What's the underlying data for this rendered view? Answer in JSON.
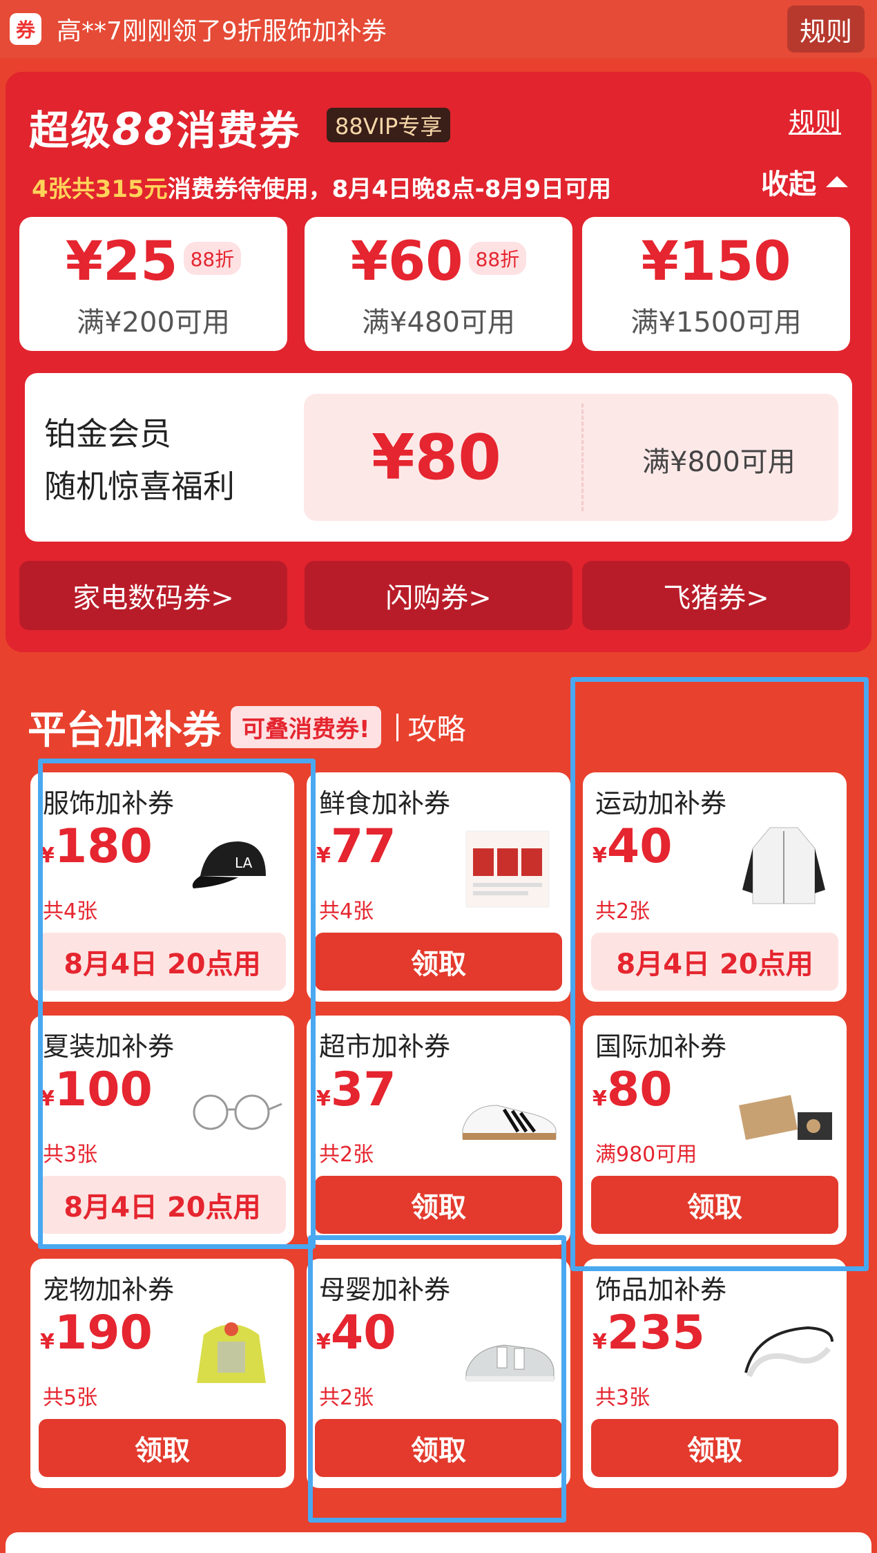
{
  "notice": {
    "icon": "ticket-icon",
    "icon_glyph": "券",
    "text": "高**7刚刚领了9折服饰加补券",
    "rule": "规则"
  },
  "super88": {
    "title_pre": "超级",
    "title_num": "88",
    "title_post": "消费券",
    "vip_badge": "88VIP专享",
    "rule": "规则",
    "sub_hl": "4张共315元",
    "sub_rest": "消费券待使用，8月4日晚8点-8月9日可用",
    "collapse": "收起",
    "coupons": [
      {
        "amount": "¥25",
        "badge": "88折",
        "cond": "满¥200可用"
      },
      {
        "amount": "¥60",
        "badge": "88折",
        "cond": "满¥480可用"
      },
      {
        "amount": "¥150",
        "badge": "",
        "cond": "满¥1500可用"
      }
    ],
    "platinum": {
      "line1": "铂金会员",
      "line2": "随机惊喜福利",
      "amount": "¥80",
      "cond": "满¥800可用"
    },
    "categories": [
      "家电数码券>",
      "闪购券>",
      "飞猪券>"
    ]
  },
  "platform": {
    "title": "平台加补券",
    "badge": "可叠消费券!",
    "guide": "攻略",
    "cards": [
      {
        "name": "服饰加补券",
        "yen": "¥",
        "amount": "180",
        "count": "共4张",
        "button": "8月4日 20点用",
        "pending": true,
        "icon": "cap-icon"
      },
      {
        "name": "鲜食加补券",
        "yen": "¥",
        "amount": "77",
        "count": "共4张",
        "button": "领取",
        "pending": false,
        "icon": "recipe-card-icon"
      },
      {
        "name": "运动加补券",
        "yen": "¥",
        "amount": "40",
        "count": "共2张",
        "button": "8月4日 20点用",
        "pending": true,
        "icon": "jacket-icon"
      },
      {
        "name": "夏装加补券",
        "yen": "¥",
        "amount": "100",
        "count": "共3张",
        "button": "8月4日 20点用",
        "pending": true,
        "icon": "glasses-icon"
      },
      {
        "name": "超市加补券",
        "yen": "¥",
        "amount": "37",
        "count": "共2张",
        "button": "领取",
        "pending": false,
        "icon": "sneaker-icon"
      },
      {
        "name": "国际加补券",
        "yen": "¥",
        "amount": "80",
        "count": "满980可用",
        "button": "领取",
        "pending": false,
        "icon": "gift-box-icon"
      },
      {
        "name": "宠物加补券",
        "yen": "¥",
        "amount": "190",
        "count": "共5张",
        "button": "领取",
        "pending": false,
        "icon": "pet-tent-icon"
      },
      {
        "name": "母婴加补券",
        "yen": "¥",
        "amount": "40",
        "count": "共2张",
        "button": "领取",
        "pending": false,
        "icon": "baby-shoe-icon"
      },
      {
        "name": "饰品加补券",
        "yen": "¥",
        "amount": "235",
        "count": "共3张",
        "button": "领取",
        "pending": false,
        "icon": "headband-icon"
      }
    ]
  },
  "highlight_color": "#4aa8f0",
  "accent": "#e5252f"
}
